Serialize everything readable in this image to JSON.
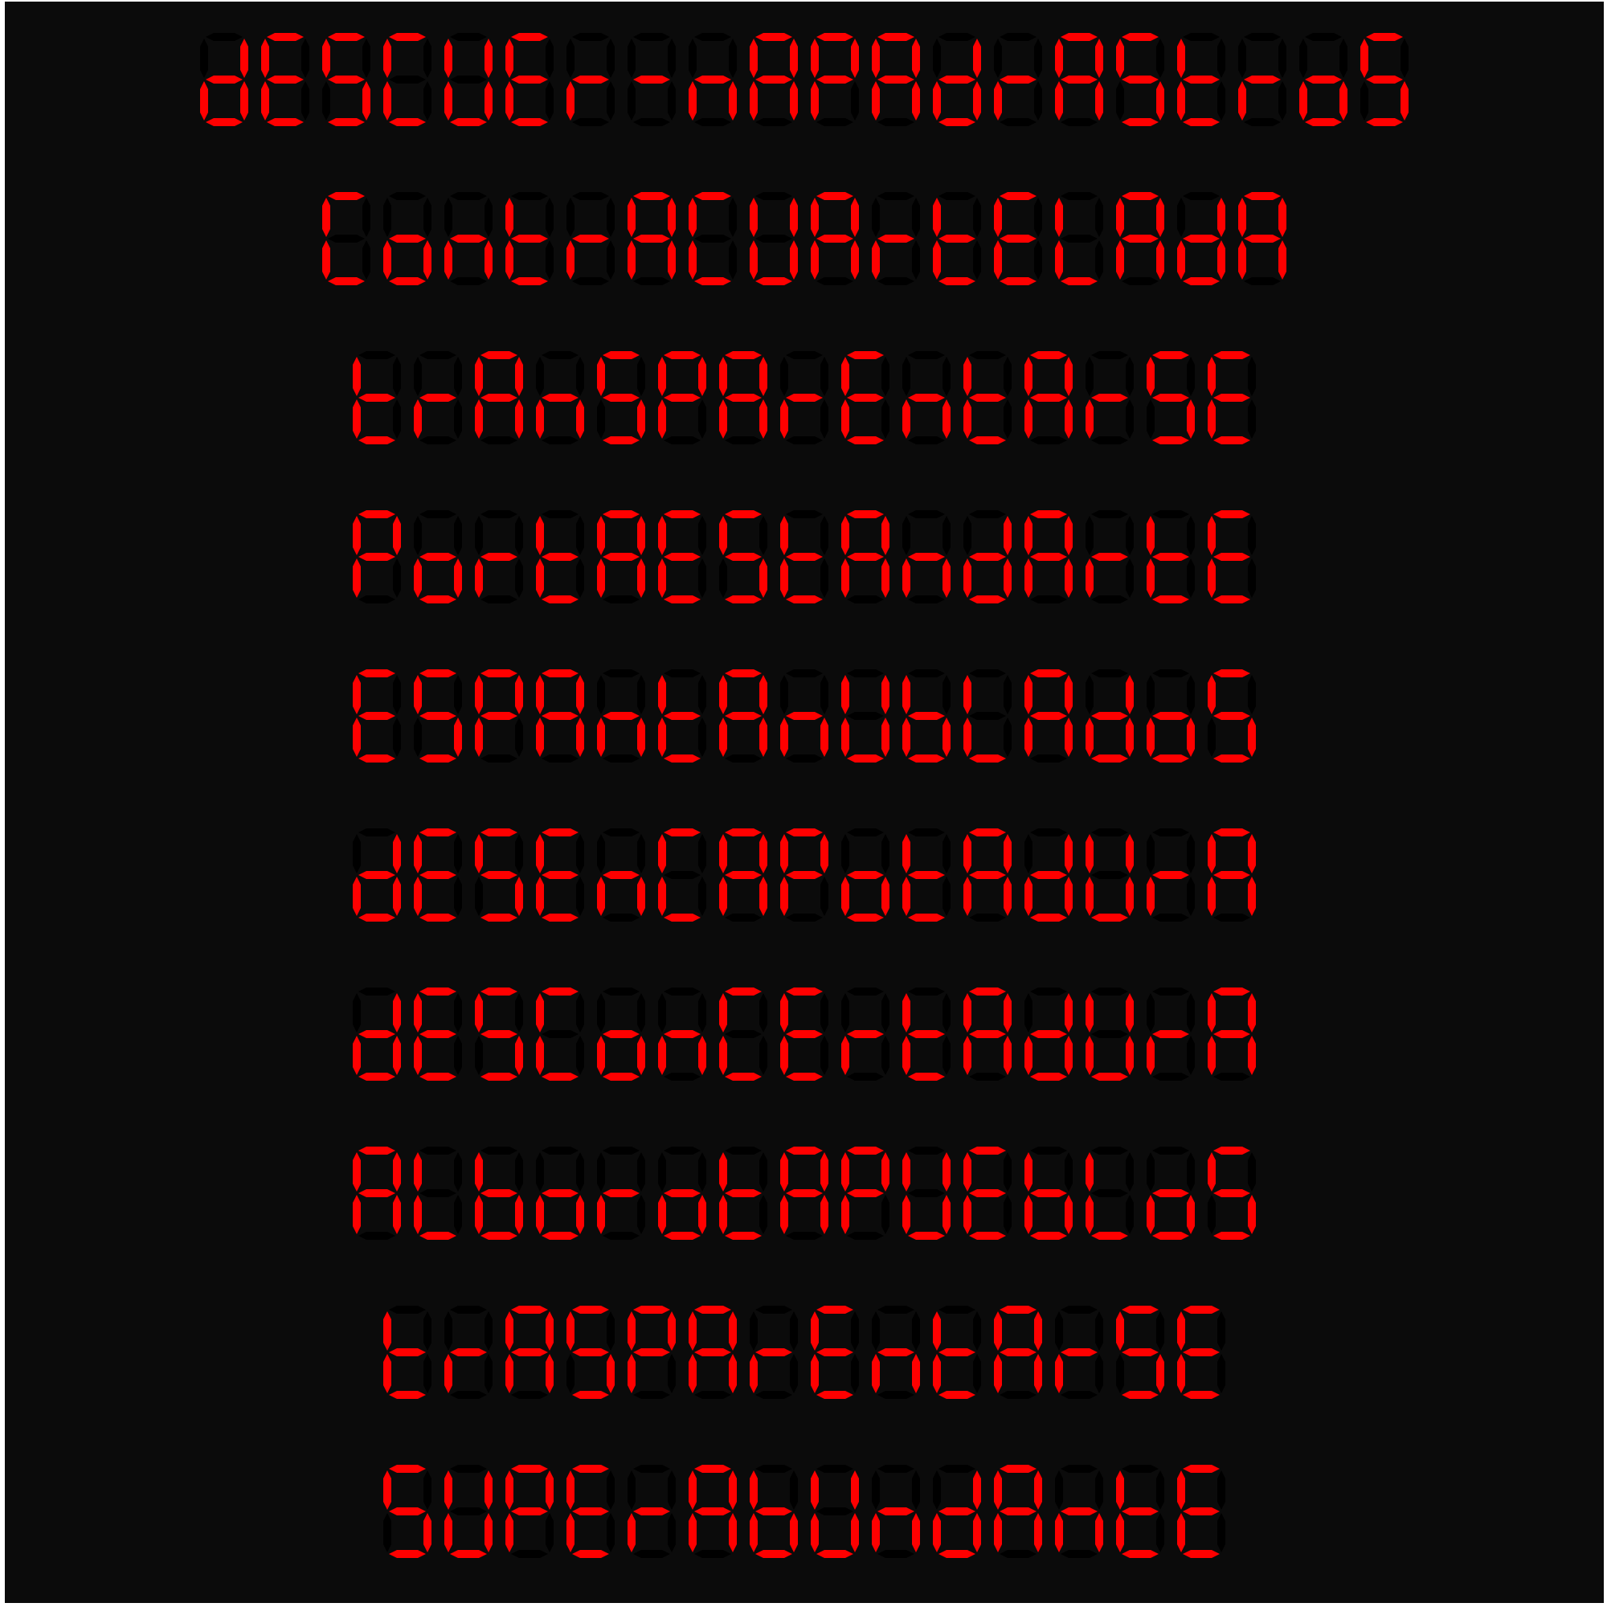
{
  "lines": [
    "dESCUEr-nAPAdrAStrOS",
    "COntrACUArtELAdA",
    "trAnSPArEntArSE",
    "POrtAEStAndArtE",
    "ESPAntAnUbLAdOS",
    "dESEnCAPOtAdUrA",
    "dESCOnCErtAdUrA",
    "ALbOrOtAPUEbLOS",
    "trASPArEntArSE",
    "SUPErAbUndAntE"
  ],
  "colors": {
    "segment_on": "#ff0000",
    "segment_off": "#000000",
    "background": "#0b0b0b"
  }
}
